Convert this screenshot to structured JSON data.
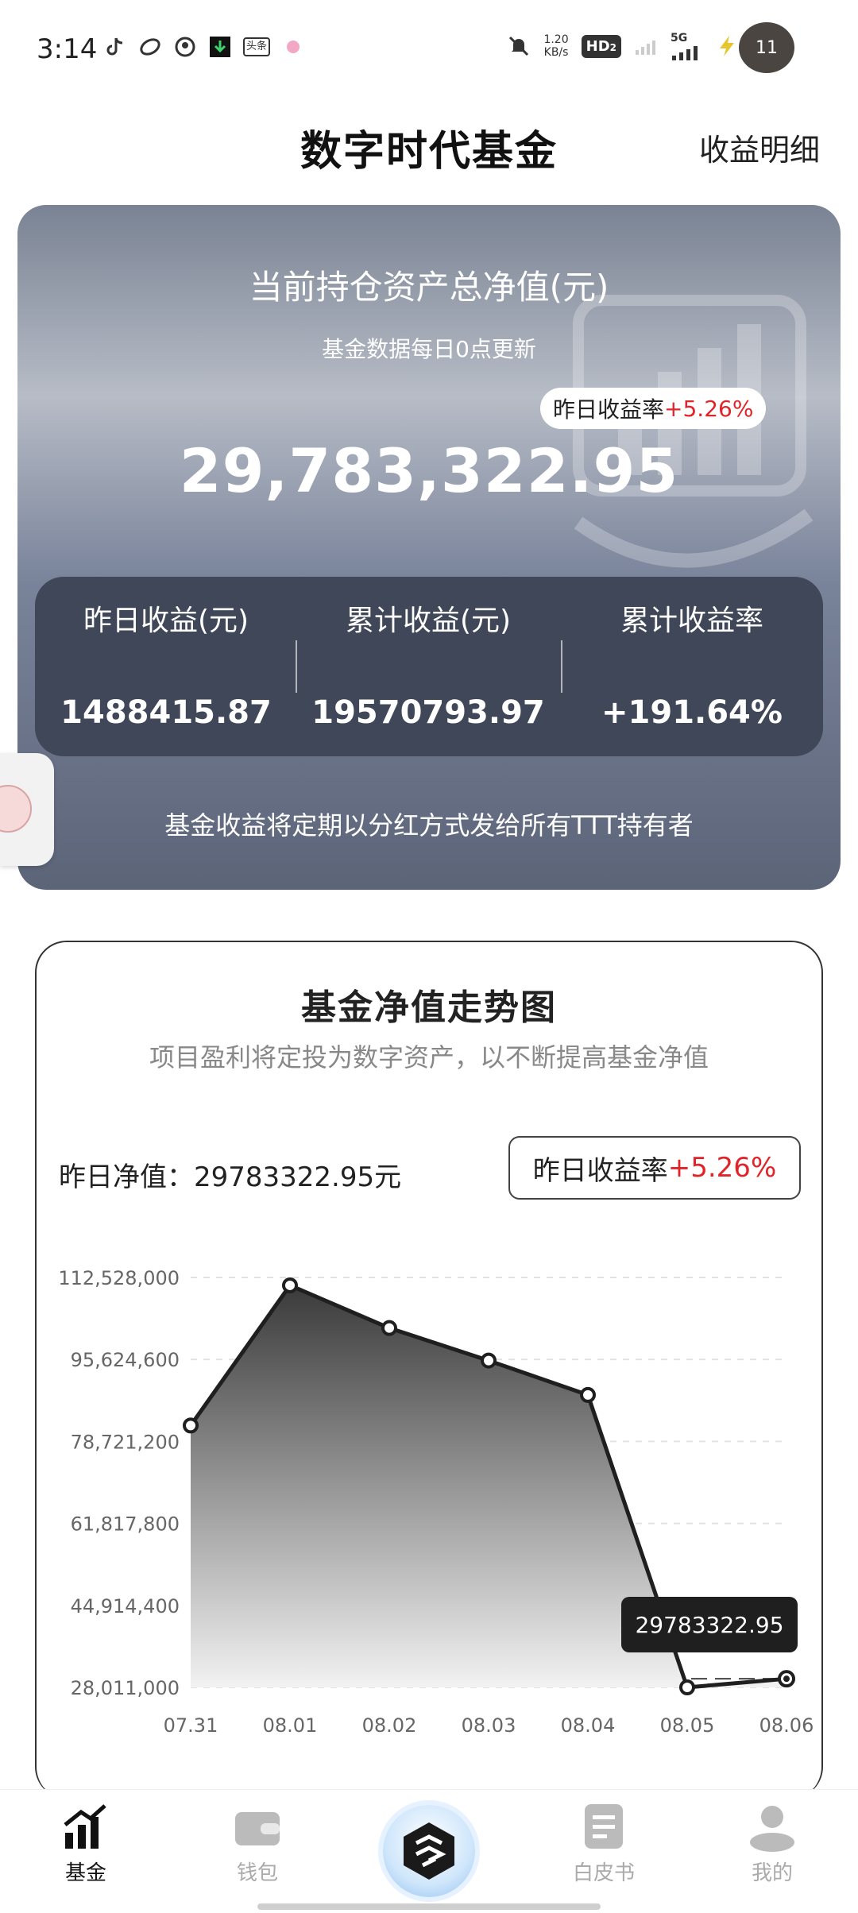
{
  "status_bar": {
    "time": "3:14",
    "left_icons": [
      "tiktok-icon",
      "app-icon",
      "app-icon",
      "download-icon",
      "toutiao-icon",
      "dot-icon"
    ],
    "news_label": "头条",
    "net_speed_value": "1.20",
    "net_speed_unit": "KB/s",
    "hd_label": "HD",
    "hd_sub": "2",
    "signal_label": "5G",
    "avatar_badge": "11"
  },
  "header": {
    "title": "数字时代基金",
    "detail_link": "收益明细"
  },
  "asset_card": {
    "title": "当前持仓资产总净值(元)",
    "subtitle": "基金数据每日0点更新",
    "rate_label": "昨日收益率",
    "rate_value": "+5.26%",
    "total_value": "29,783,322.95",
    "stats": [
      {
        "label": "昨日收益(元)",
        "value": "1488415.87"
      },
      {
        "label": "累计收益(元)",
        "value": "19570793.97"
      },
      {
        "label": "累计收益率",
        "value": "+191.64%"
      }
    ],
    "footer": "基金收益将定期以分红方式发给所有TTT持有者"
  },
  "chart_section": {
    "title": "基金净值走势图",
    "subtitle": "项目盈利将定投为数字资产，以不断提高基金净值",
    "nav_label": "昨日净值：",
    "nav_value": "29783322.95元",
    "rate_label": "昨日收益率",
    "rate_value": "+5.26%",
    "tooltip_value": "29783322.95"
  },
  "chart_data": {
    "type": "area",
    "title": "基金净值走势图",
    "x": [
      "07.31",
      "08.01",
      "08.02",
      "08.03",
      "08.04",
      "08.05",
      "08.06"
    ],
    "series": [
      {
        "values": [
          82000000,
          110900000,
          102100000,
          95400000,
          88300000,
          28011000,
          29783322.95
        ]
      }
    ],
    "y_ticks": [
      28011000,
      44914400,
      61817800,
      78721200,
      95624600,
      112528000
    ],
    "y_tick_labels": [
      "28,011,000",
      "44,914,400",
      "61,817,800",
      "78,721,200",
      "95,624,600",
      "112,528,000"
    ],
    "ylim": [
      28011000,
      112528000
    ],
    "reference_line": 29783322.95,
    "grid": true,
    "colors": {
      "line": "#1f1f1f",
      "fill_top": "#3a3a3a",
      "fill_bottom": "#f2f2f2"
    }
  },
  "bottom_nav": {
    "items": [
      {
        "label": "基金",
        "icon": "chart-bars-icon",
        "active": true
      },
      {
        "label": "钱包",
        "icon": "wallet-icon",
        "active": false
      },
      {
        "label": "",
        "icon": "logo-icon",
        "active": false
      },
      {
        "label": "白皮书",
        "icon": "document-icon",
        "active": false
      },
      {
        "label": "我的",
        "icon": "user-icon",
        "active": false
      }
    ]
  },
  "colors": {
    "accent_positive": "#e0242a",
    "card_dark": "#3f4758"
  }
}
